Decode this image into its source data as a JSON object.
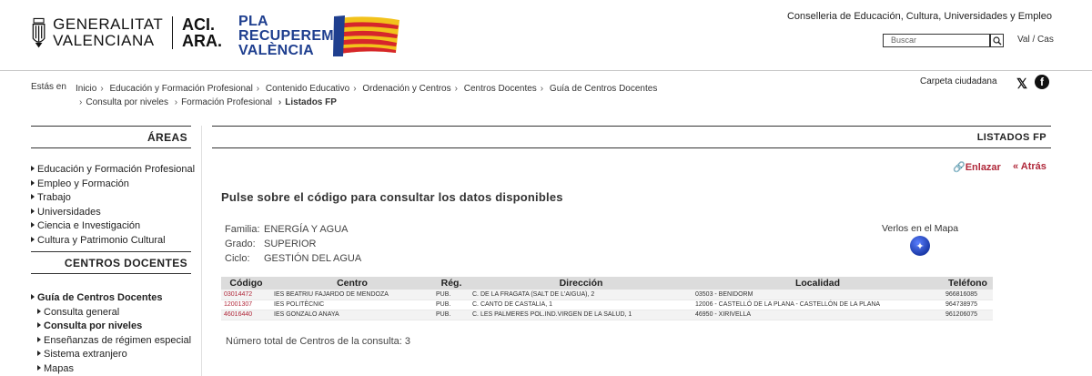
{
  "header": {
    "gva_line1": "GENERALITAT",
    "gva_line2": "VALENCIANA",
    "aci_line1": "ACI.",
    "aci_line2": "ARA.",
    "pla_line1": "PLA",
    "pla_line2": "RECUPEREM",
    "pla_line3": "VALÈNCIA",
    "conselleria": "Conselleria de Educación, Cultura, Universidades y Empleo",
    "search_placeholder": "Buscar",
    "lang": "Val / Cas",
    "carpeta": "Carpeta ciudadana",
    "colors": {
      "flag_red": "#d6262b",
      "flag_yellow": "#f2c21b",
      "flag_blue": "#1f3f8f",
      "link_red": "#b0283a"
    }
  },
  "breadcrumb": {
    "label": "Estás en",
    "items": [
      "Inicio",
      "Educación y Formación Profesional",
      "Contenido Educativo",
      "Ordenación y Centros",
      "Centros Docentes",
      "Guía de Centros Docentes",
      "Consulta por niveles",
      "Formación Profesional",
      "Listados FP"
    ]
  },
  "sidebar": {
    "areas_title": "ÁREAS",
    "areas": [
      "Educación y Formación Profesional",
      "Empleo y Formación",
      "Trabajo",
      "Universidades",
      "Ciencia e Investigación",
      "Cultura y Patrimonio Cultural"
    ],
    "centros_title": "CENTROS DOCENTES",
    "centros": [
      "Guía de Centros Docentes",
      "Consulta general",
      "Consulta por niveles",
      "Enseñanzas de régimen especial",
      "Sistema extranjero",
      "Mapas"
    ]
  },
  "main": {
    "title": "LISTADOS FP",
    "enlazar": "Enlazar",
    "atras": "« Atrás",
    "instruction": "Pulse sobre el código para consultar los datos disponibles",
    "familia_label": "Familia:",
    "familia": "ENERGÍA Y AGUA",
    "grado_label": "Grado:",
    "grado": "SUPERIOR",
    "ciclo_label": "Ciclo:",
    "ciclo": "GESTIÓN DEL AGUA",
    "map_label": "Verlos en el Mapa",
    "total": "Número total de Centros de la consulta: 3"
  },
  "table": {
    "headers": [
      "Código",
      "Centro",
      "Rég.",
      "Dirección",
      "Localidad",
      "Teléfono"
    ],
    "rows": [
      [
        "03014472",
        "IES BEATRIU FAJARDO DE MENDOZA",
        "PUB.",
        "C. DE LA FRAGATA (SALT DE L'AIGUA), 2",
        "03503 - BENIDORM",
        "966816085"
      ],
      [
        "12001307",
        "IES POLITÈCNIC",
        "PUB.",
        "C. CANTO DE CASTALIA, 1",
        "12006 - CASTELLÓ DE LA PLANA - CASTELLÓN DE LA PLANA",
        "964738975"
      ],
      [
        "46016440",
        "IES GONZALO ANAYA",
        "PUB.",
        "C. LES PALMERES POL.IND.VIRGEN DE LA SALUD, 1",
        "46950 - XIRIVELLA",
        "961206075"
      ]
    ]
  }
}
